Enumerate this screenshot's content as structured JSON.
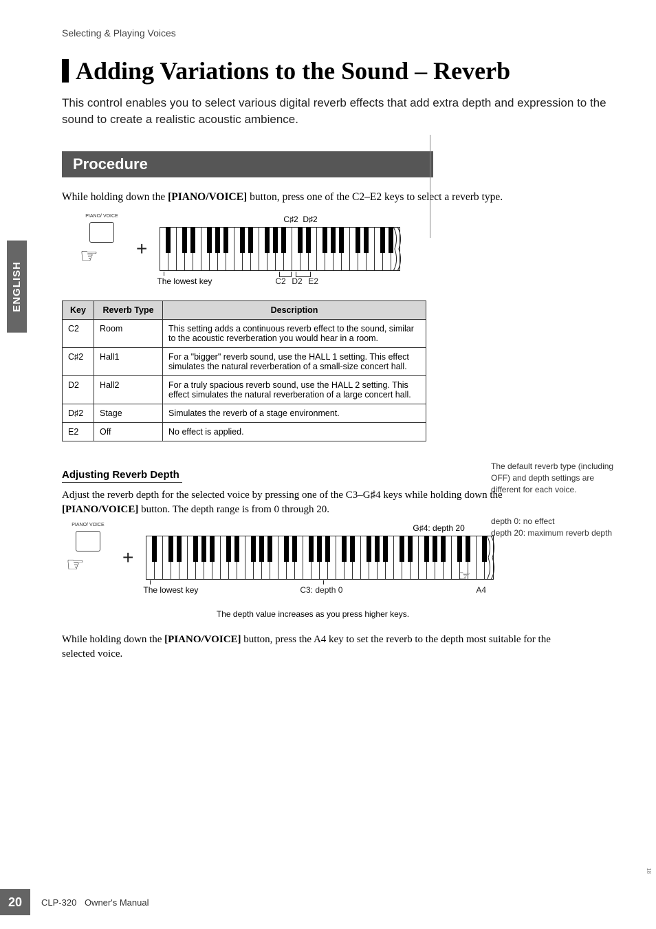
{
  "sideTab": "ENGLISH",
  "breadcrumb": "Selecting & Playing Voices",
  "title": "Adding Variations to the Sound – Reverb",
  "intro": "This control enables you to select various digital reverb effects that add extra depth and expression to the sound to create a realistic acoustic ambience.",
  "procHeading": "Procedure",
  "procBody1": "While holding down the ",
  "procBodyBtn": "[PIANO/VOICE]",
  "procBody2": " button, press one of the C2–E2 keys to select a reverb type.",
  "btnLabel": "PIANO/\nVOICE",
  "lowestKeyLabel": "The lowest key",
  "fig1": {
    "topLabels": {
      "csharp2": "C♯2",
      "dsharp2": "D♯2"
    },
    "botLabels": {
      "c2": "C2",
      "d2": "D2",
      "e2": "E2"
    }
  },
  "table": {
    "head": {
      "key": "Key",
      "type": "Reverb Type",
      "desc": "Description"
    },
    "rows": [
      {
        "key": "C2",
        "type": "Room",
        "desc": "This setting adds a continuous reverb effect to the sound, similar to the acoustic reverberation you would hear in a room."
      },
      {
        "key": "C♯2",
        "type": "Hall1",
        "desc": "For a \"bigger\" reverb sound, use the HALL 1 setting. This effect simulates the natural reverberation of a small-size concert hall."
      },
      {
        "key": "D2",
        "type": "Hall2",
        "desc": "For a truly spacious reverb sound, use the HALL 2 setting. This effect simulates the natural reverberation of a large concert hall."
      },
      {
        "key": "D♯2",
        "type": "Stage",
        "desc": "Simulates the reverb of a stage environment."
      },
      {
        "key": "E2",
        "type": "Off",
        "desc": "No effect is applied."
      }
    ]
  },
  "depthHead": "Adjusting Reverb Depth",
  "depthBody1": "Adjust the reverb depth for the selected voice by pressing one of the C3–G♯4 keys while holding down the ",
  "depthBodyBtn": "[PIANO/VOICE]",
  "depthBody2": " button. The depth range is from 0 through 20.",
  "fig2": {
    "top": "G♯4: depth 20",
    "c3": "C3: depth 0",
    "a4": "A4"
  },
  "afterFig": "The depth value increases as you press higher keys.",
  "postBody1": "While holding down the ",
  "postBodyBtn": "[PIANO/VOICE]",
  "postBody2": " button, press the A4 key to set the reverb to the depth most suitable for the selected voice.",
  "side1": "The default reverb type (including OFF) and depth settings are different for each voice.",
  "side2": "depth 0: no effect\ndepth 20: maximum reverb depth",
  "page": "20",
  "model": "CLP-320",
  "footerText": "Owner's Manual",
  "tinyNum": "18"
}
